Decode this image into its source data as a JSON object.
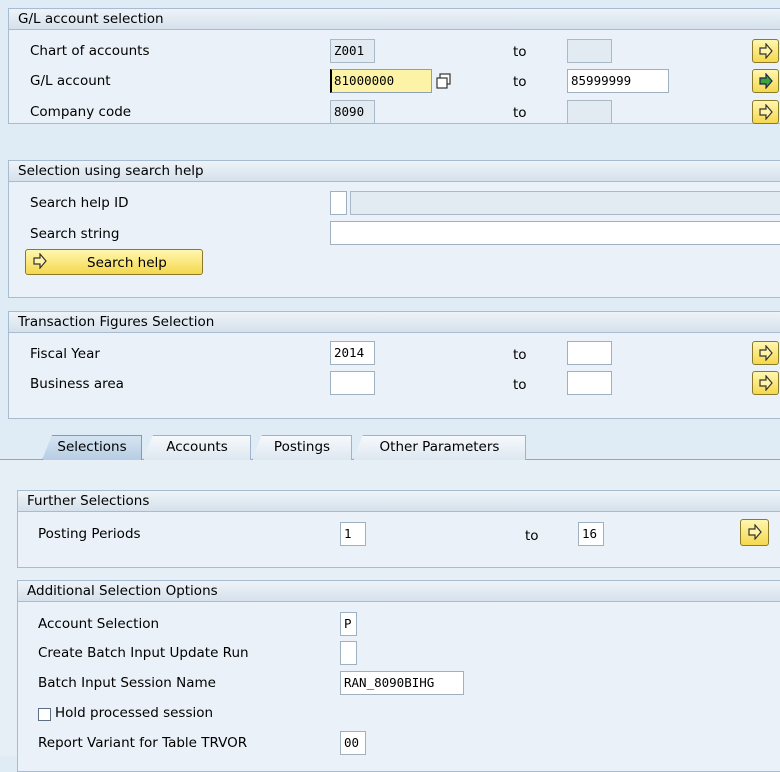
{
  "gl_selection": {
    "title": "G/L account selection",
    "to_label": "to",
    "chart_of_accounts": {
      "label": "Chart of accounts",
      "from": "Z001",
      "to": ""
    },
    "gl_account": {
      "label": "G/L account",
      "from": "81000000",
      "to": "85999999"
    },
    "company_code": {
      "label": "Company code",
      "from": "8090",
      "to": ""
    }
  },
  "search_help": {
    "title": "Selection using search help",
    "search_help_id": {
      "label": "Search help ID",
      "value": "",
      "description": ""
    },
    "search_string": {
      "label": "Search string",
      "value": ""
    },
    "button_label": "Search help"
  },
  "transaction_figures": {
    "title": "Transaction Figures Selection",
    "to_label": "to",
    "fiscal_year": {
      "label": "Fiscal Year",
      "from": "2014",
      "to": ""
    },
    "business_area": {
      "label": "Business area",
      "from": "",
      "to": ""
    }
  },
  "tabs": [
    {
      "label": "Selections",
      "active": true
    },
    {
      "label": "Accounts",
      "active": false
    },
    {
      "label": "Postings",
      "active": false
    },
    {
      "label": "Other Parameters",
      "active": false
    }
  ],
  "further_selections": {
    "title": "Further Selections",
    "posting_periods": {
      "label": "Posting Periods",
      "from": "1",
      "to": "16"
    },
    "to_label": "to"
  },
  "additional_options": {
    "title": "Additional Selection Options",
    "account_selection": {
      "label": "Account Selection",
      "value": "P"
    },
    "create_batch_input": {
      "label": "Create Batch Input Update Run",
      "value": ""
    },
    "batch_session_name": {
      "label": "Batch Input Session Name",
      "value": "RAN_8090BIHG"
    },
    "hold_processed": {
      "label": "Hold processed session",
      "checked": false
    },
    "report_variant": {
      "label": "Report Variant for Table TRVOR",
      "value": "00"
    }
  },
  "icons": {
    "multiple_selection": "arrow-right-icon",
    "multiple_selection_active": "arrow-right-green-icon",
    "copy": "copy-icon"
  },
  "colors": {
    "background": "#dfebf5",
    "button": "#f5d84e",
    "highlight_field": "#fdf3a6",
    "active_arrow": "#3aa43a"
  }
}
